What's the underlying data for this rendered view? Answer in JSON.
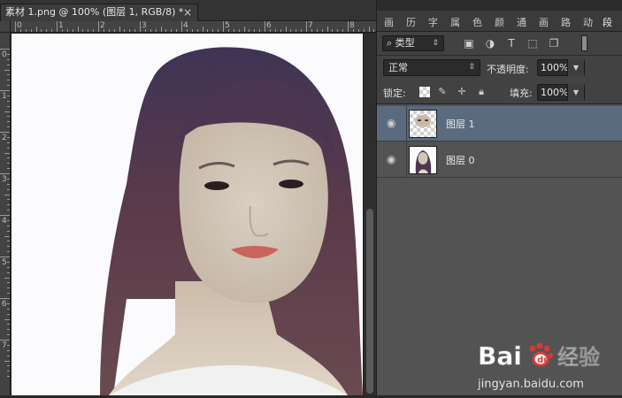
{
  "document": {
    "tab_title": "素材 1.png @ 100% (图层 1, RGB/8) *",
    "close_symbol": "×",
    "ruler_h_labels": [
      "0",
      "1",
      "2",
      "3",
      "4",
      "5",
      "6",
      "7",
      "8"
    ],
    "ruler_v_labels": [
      "0",
      "1",
      "2",
      "3",
      "4",
      "5",
      "6",
      "7"
    ]
  },
  "panel_tabs": [
    "画",
    "历",
    "字",
    "属",
    "色",
    "颜",
    "通",
    "画",
    "路",
    "动",
    "段"
  ],
  "layers_panel": {
    "filter_icon": "search-icon",
    "kind_label": "类型",
    "blend_mode": "正常",
    "opacity_label": "不透明度:",
    "opacity_value": "100%",
    "lock_label": "锁定:",
    "fill_label": "填充:",
    "fill_value": "100%",
    "layers": [
      {
        "name": "图层 1",
        "selected": true,
        "visible": true
      },
      {
        "name": "图层 0",
        "selected": false,
        "visible": true
      }
    ]
  },
  "watermark": {
    "brand": "Bai",
    "brand_suffix": "经验",
    "url": "jingyan.baidu.com"
  },
  "colors": {
    "selected_layer": "#5a6b80",
    "panel_bg": "#535353",
    "watermark_red": "#d23c36"
  }
}
